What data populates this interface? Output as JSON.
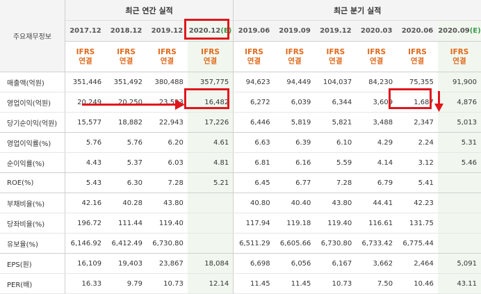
{
  "header": {
    "row_label": "주요재무정보",
    "annual_title": "최근 연간 실적",
    "quarter_title": "최근 분기 실적",
    "ifrs_top": "IFRS",
    "ifrs_bottom": "연결",
    "columns": [
      {
        "date": "2017.12",
        "est": ""
      },
      {
        "date": "2018.12",
        "est": ""
      },
      {
        "date": "2019.12",
        "est": ""
      },
      {
        "date": "2020.12",
        "est": "(E)"
      },
      {
        "date": "2019.06",
        "est": ""
      },
      {
        "date": "2019.09",
        "est": ""
      },
      {
        "date": "2019.12",
        "est": ""
      },
      {
        "date": "2020.03",
        "est": ""
      },
      {
        "date": "2020.06",
        "est": ""
      },
      {
        "date": "2020.09",
        "est": "(E)"
      }
    ]
  },
  "rows": [
    {
      "label": "매출액(억원)",
      "values": [
        "351,446",
        "351,492",
        "380,488",
        "357,775",
        "94,623",
        "94,449",
        "104,037",
        "84,230",
        "75,355",
        "91,900"
      ]
    },
    {
      "label": "영업이익(억원)",
      "values": [
        "20,249",
        "20,250",
        "23,593",
        "16,482",
        "6,272",
        "6,039",
        "6,344",
        "3,609",
        "1,687",
        "4,876"
      ]
    },
    {
      "label": "당기순이익(억원)",
      "values": [
        "15,577",
        "18,882",
        "22,943",
        "17,226",
        "6,446",
        "5,819",
        "5,821",
        "3,488",
        "2,347",
        "5,013"
      ]
    },
    {
      "label": "영업이익률(%)",
      "values": [
        "5.76",
        "5.76",
        "6.20",
        "4.61",
        "6.63",
        "6.39",
        "6.10",
        "4.29",
        "2.24",
        "5.31"
      ]
    },
    {
      "label": "순이익률(%)",
      "values": [
        "4.43",
        "5.37",
        "6.03",
        "4.81",
        "6.81",
        "6.16",
        "5.59",
        "4.14",
        "3.12",
        "5.46"
      ]
    },
    {
      "label": "ROE(%)",
      "values": [
        "5.43",
        "6.30",
        "7.28",
        "5.21",
        "6.45",
        "6.77",
        "7.28",
        "6.79",
        "5.41",
        ""
      ]
    },
    {
      "label": "부채비율(%)",
      "values": [
        "42.16",
        "40.28",
        "43.80",
        "",
        "40.80",
        "40.40",
        "43.80",
        "44.41",
        "42.23",
        ""
      ]
    },
    {
      "label": "당좌비율(%)",
      "values": [
        "196.72",
        "111.44",
        "119.40",
        "",
        "117.94",
        "119.18",
        "119.40",
        "116.61",
        "131.75",
        ""
      ]
    },
    {
      "label": "유보율(%)",
      "values": [
        "6,146.92",
        "6,412.49",
        "6,730.80",
        "",
        "6,511.29",
        "6,605.66",
        "6,730.80",
        "6,733.42",
        "6,775.44",
        ""
      ]
    },
    {
      "label": "EPS(원)",
      "values": [
        "16,109",
        "19,403",
        "23,867",
        "18,084",
        "6,698",
        "6,056",
        "6,167",
        "3,662",
        "2,464",
        "5,091"
      ]
    },
    {
      "label": "PER(배)",
      "values": [
        "16.33",
        "9.79",
        "10.73",
        "12.14",
        "11.45",
        "11.45",
        "10.73",
        "7.50",
        "10.46",
        "43.11"
      ]
    }
  ],
  "colors": {
    "highlight": "#e0161c",
    "ifrs": "#e06a1c",
    "estimate_bg": "#f1f7ee"
  }
}
